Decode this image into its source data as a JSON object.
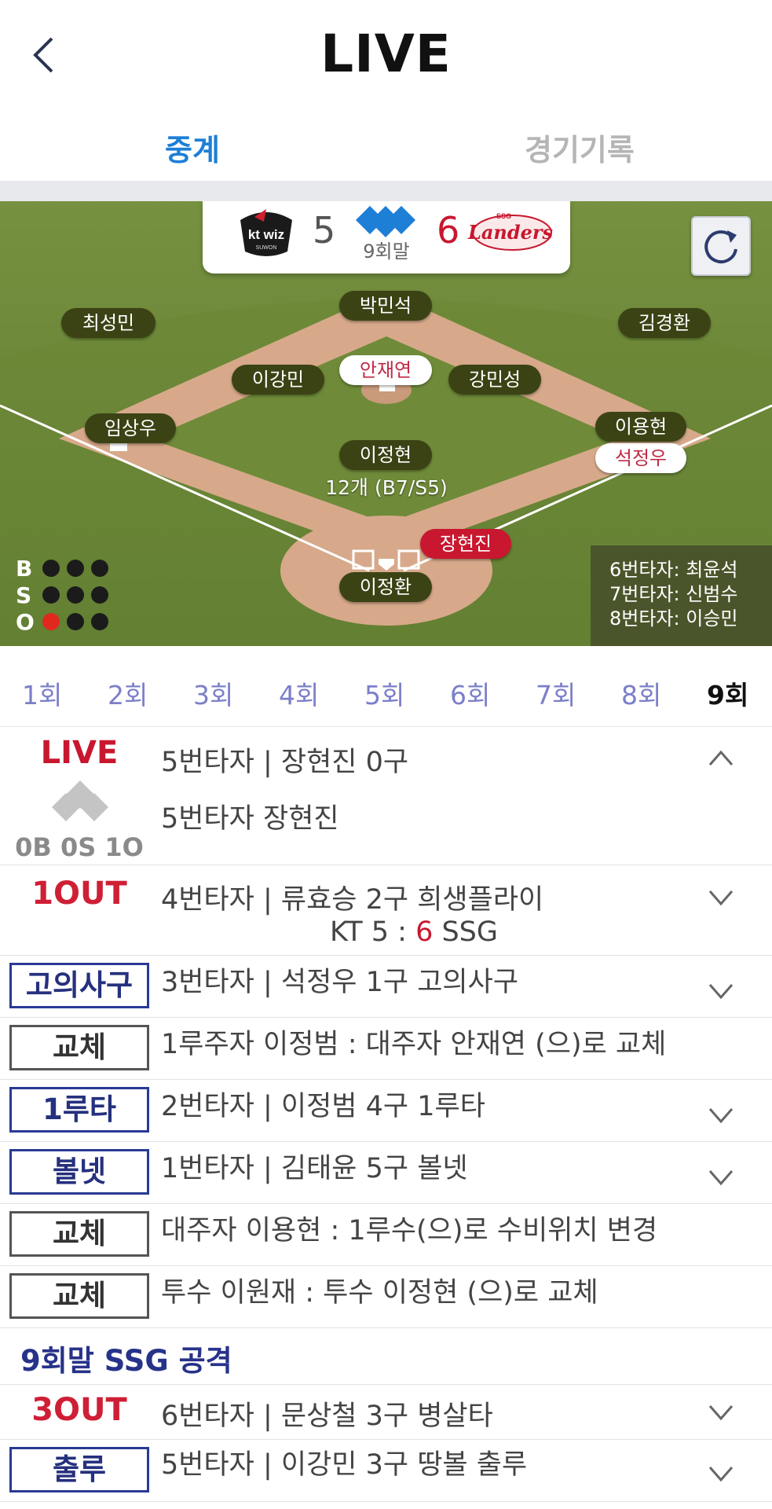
{
  "header": {
    "title": "LIVE",
    "back_icon": "chevron-left-icon"
  },
  "tabs": [
    {
      "label": "중계",
      "active": true
    },
    {
      "label": "경기기록",
      "active": false
    }
  ],
  "scoreboard": {
    "away_team": "KT",
    "away_score": "5",
    "home_team": "SSG",
    "home_score": "6",
    "inning": "9회말",
    "ssg_logo_text": "Landers"
  },
  "field": {
    "players": {
      "lf": "최성민",
      "cf": "박민석",
      "rf": "김경환",
      "ss": "이강민",
      "runner2": "안재연",
      "second": "강민성",
      "third": "임상우",
      "first": "이용현",
      "runner1": "석정우",
      "pitcher": "이정현",
      "batter": "장현진",
      "catcher": "이정환"
    },
    "pitch_count": "12개 (B7/S5)",
    "bso": {
      "b_label": "B",
      "s_label": "S",
      "o_label": "O",
      "balls": 0,
      "strikes": 0,
      "outs": 1
    },
    "upcoming": [
      "6번타자: 최윤석",
      "7번타자: 신범수",
      "8번타자: 이승민"
    ]
  },
  "innings": [
    "1회",
    "2회",
    "3회",
    "4회",
    "5회",
    "6회",
    "7회",
    "8회",
    "9회"
  ],
  "plays": {
    "live": {
      "label": "LIVE",
      "count": "0B 0S 1O",
      "title": "5번타자 | 장현진 0구",
      "sub": "5번타자 장현진"
    },
    "out1": {
      "label": "1OUT",
      "title": "4번타자 | 류효승 2구 희생플라이",
      "score_prefix": "KT 5 : ",
      "score_highlight": "6",
      "score_suffix": " SSG"
    },
    "r3": {
      "badge": "고의사구",
      "text": "3번타자 | 석정우 1구 고의사구"
    },
    "r4": {
      "badge": "교체",
      "text": "1루주자 이정범 : 대주자 안재연 (으)로 교체"
    },
    "r5": {
      "badge": "1루타",
      "text": "2번타자 | 이정범 4구 1루타"
    },
    "r6": {
      "badge": "볼넷",
      "text": "1번타자 | 김태윤 5구 볼넷"
    },
    "r7": {
      "badge": "교체",
      "text": "대주자 이용현 : 1루수(으)로 수비위치 변경"
    },
    "r8": {
      "badge": "교체",
      "text": "투수 이원재 : 투수 이정현 (으)로 교체"
    },
    "section": "9회말 SSG 공격",
    "r9": {
      "label": "3OUT",
      "text": "6번타자 | 문상철 3구 병살타"
    },
    "r10": {
      "badge": "출루",
      "text": "5번타자 | 이강민 3구 땅볼 출루"
    }
  },
  "colors": {
    "accent": "#1e7fd6",
    "out_red": "#cf1f35",
    "badge_navy": "#2a3a94",
    "field_green": "#6b8438"
  }
}
